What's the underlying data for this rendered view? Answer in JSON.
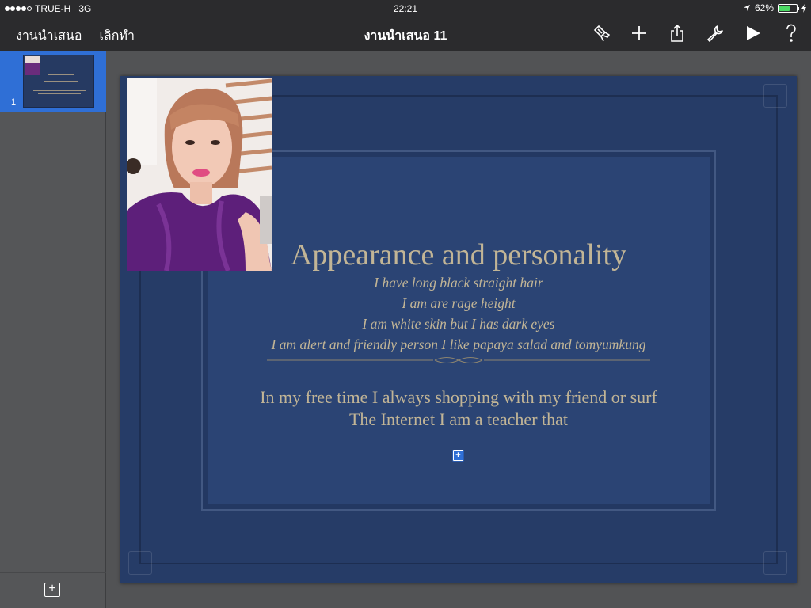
{
  "status_bar": {
    "carrier": "TRUE-H",
    "network": "3G",
    "time": "22:21",
    "battery_percent": "62%",
    "battery_level": 0.62
  },
  "nav": {
    "back_label": "งานนำเสนอ",
    "undo_label": "เลิกทำ",
    "title": "งานนำเสนอ 11",
    "icons": [
      "paintbrush-icon",
      "plus-icon",
      "share-icon",
      "wrench-icon",
      "play-icon",
      "help-icon"
    ]
  },
  "sidebar": {
    "slides": [
      {
        "number": "1",
        "selected": true
      }
    ],
    "add_slide": "+"
  },
  "slide": {
    "title": "Appearance and personality",
    "italic_lines": [
      "I have long black straight hair",
      "I am are rage height",
      "I am white skin but I has dark eyes",
      "I am alert and friendly person I like papaya salad and tomyumkung"
    ],
    "body_lines": [
      "In my free time I always shopping with my friend or surf",
      "The Internet I am a teacher that"
    ],
    "add_media": "+"
  },
  "colors": {
    "accent": "#2f6fd6",
    "slide_background": "#263c67",
    "slide_text": "#c2b596",
    "toolbar": "#2b2b2d"
  }
}
